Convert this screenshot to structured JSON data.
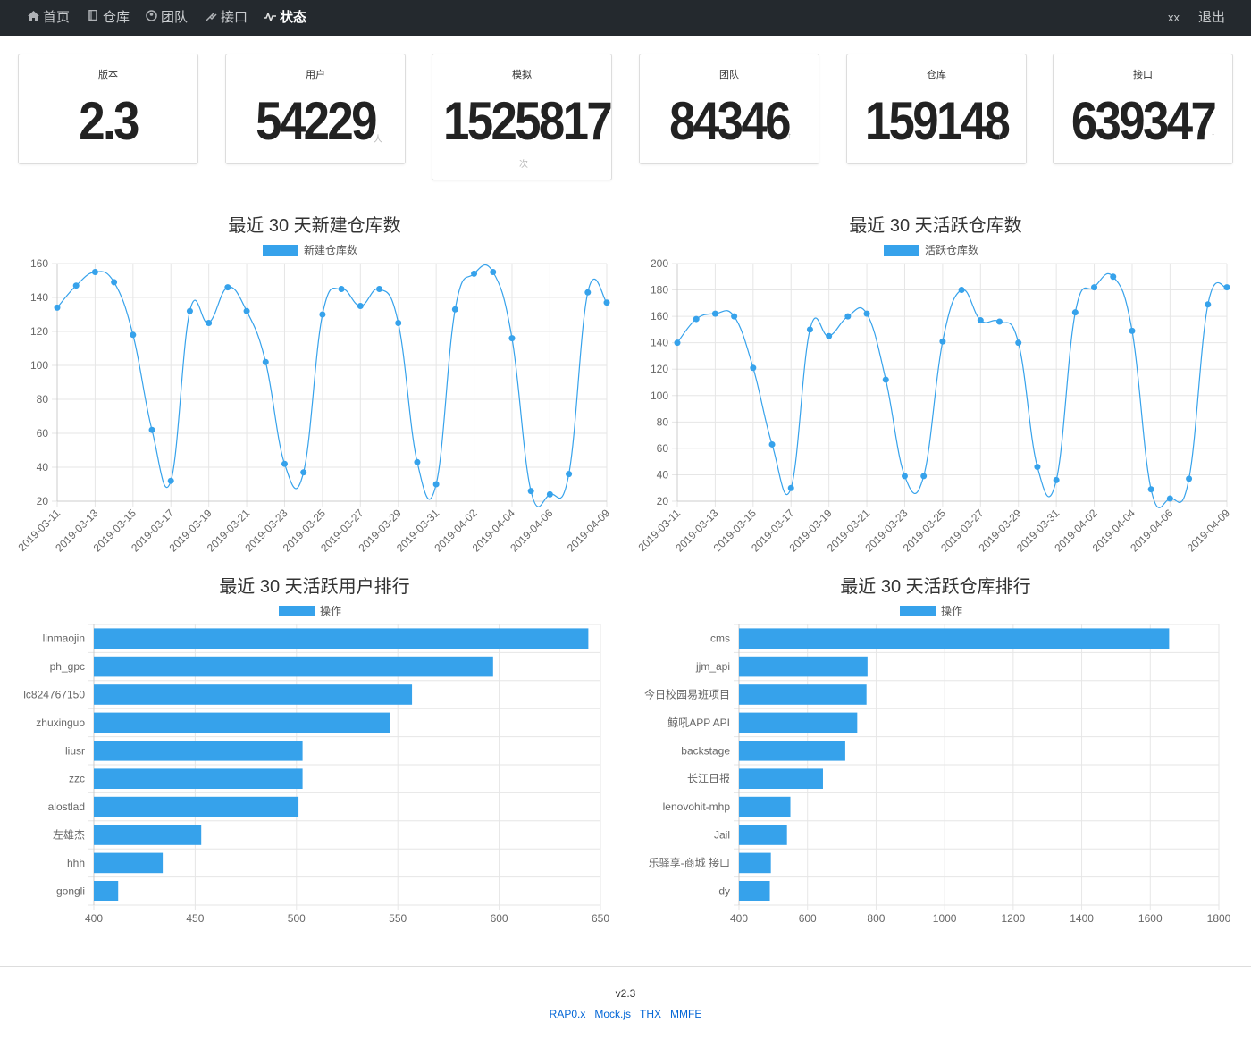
{
  "nav": {
    "items": [
      {
        "label": "首页",
        "icon": "home-icon",
        "active": false
      },
      {
        "label": "仓库",
        "icon": "book-icon",
        "active": false
      },
      {
        "label": "团队",
        "icon": "organization-icon",
        "active": false
      },
      {
        "label": "接口",
        "icon": "plug-icon",
        "active": false
      },
      {
        "label": "状态",
        "icon": "pulse-icon",
        "active": true
      }
    ],
    "user": "xx",
    "logout": "退出"
  },
  "stats": [
    {
      "title": "版本",
      "value": "2.3",
      "unit": ""
    },
    {
      "title": "用户",
      "value": "54229",
      "unit": "人"
    },
    {
      "title": "模拟",
      "value": "1525817",
      "unit": "次"
    },
    {
      "title": "团队",
      "value": "84346",
      "unit": "↑"
    },
    {
      "title": "仓库",
      "value": "159148",
      "unit": "↑"
    },
    {
      "title": "接口",
      "value": "639347",
      "unit": "↑"
    }
  ],
  "colors": {
    "accent": "#36a2eb",
    "navbar": "#24292e",
    "link": "#0366d6"
  },
  "chart_data": [
    {
      "type": "line",
      "title": "最近 30 天新建仓库数",
      "series": [
        {
          "name": "新建仓库数",
          "values": [
            134,
            147,
            155,
            149,
            118,
            62,
            32,
            132,
            125,
            146,
            132,
            102,
            42,
            37,
            130,
            145,
            135,
            145,
            125,
            43,
            30,
            133,
            154,
            155,
            116,
            26,
            24,
            36,
            143,
            137
          ]
        }
      ],
      "x": [
        "2019-03-11",
        "2019-03-12",
        "2019-03-13",
        "2019-03-14",
        "2019-03-15",
        "2019-03-16",
        "2019-03-17",
        "2019-03-18",
        "2019-03-19",
        "2019-03-20",
        "2019-03-21",
        "2019-03-22",
        "2019-03-23",
        "2019-03-24",
        "2019-03-25",
        "2019-03-26",
        "2019-03-27",
        "2019-03-28",
        "2019-03-29",
        "2019-03-30",
        "2019-03-31",
        "2019-04-01",
        "2019-04-02",
        "2019-04-03",
        "2019-04-04",
        "2019-04-05",
        "2019-04-06",
        "2019-04-07",
        "2019-04-08",
        "2019-04-09"
      ],
      "x_tick_labels": [
        "2019-03-11",
        "2019-03-13",
        "2019-03-15",
        "2019-03-17",
        "2019-03-19",
        "2019-03-21",
        "2019-03-23",
        "2019-03-25",
        "2019-03-27",
        "2019-03-29",
        "2019-03-31",
        "2019-04-02",
        "2019-04-04",
        "2019-04-06",
        "2019-04-09"
      ],
      "ylim": [
        20,
        160
      ],
      "y_ticks": [
        20,
        40,
        60,
        80,
        100,
        120,
        140,
        160
      ],
      "legend": "top",
      "grid": true
    },
    {
      "type": "line",
      "title": "最近 30 天活跃仓库数",
      "series": [
        {
          "name": "活跃仓库数",
          "values": [
            140,
            158,
            162,
            160,
            121,
            63,
            30,
            150,
            145,
            160,
            162,
            112,
            39,
            39,
            141,
            180,
            157,
            156,
            140,
            46,
            36,
            163,
            182,
            190,
            149,
            29,
            22,
            37,
            169,
            182
          ]
        }
      ],
      "x": [
        "2019-03-11",
        "2019-03-12",
        "2019-03-13",
        "2019-03-14",
        "2019-03-15",
        "2019-03-16",
        "2019-03-17",
        "2019-03-18",
        "2019-03-19",
        "2019-03-20",
        "2019-03-21",
        "2019-03-22",
        "2019-03-23",
        "2019-03-24",
        "2019-03-25",
        "2019-03-26",
        "2019-03-27",
        "2019-03-28",
        "2019-03-29",
        "2019-03-30",
        "2019-03-31",
        "2019-04-01",
        "2019-04-02",
        "2019-04-03",
        "2019-04-04",
        "2019-04-05",
        "2019-04-06",
        "2019-04-07",
        "2019-04-08",
        "2019-04-09"
      ],
      "x_tick_labels": [
        "2019-03-11",
        "2019-03-13",
        "2019-03-15",
        "2019-03-17",
        "2019-03-19",
        "2019-03-21",
        "2019-03-23",
        "2019-03-25",
        "2019-03-27",
        "2019-03-29",
        "2019-03-31",
        "2019-04-02",
        "2019-04-04",
        "2019-04-06",
        "2019-04-09"
      ],
      "ylim": [
        20,
        200
      ],
      "y_ticks": [
        20,
        40,
        60,
        80,
        100,
        120,
        140,
        160,
        180,
        200
      ],
      "legend": "top",
      "grid": true
    },
    {
      "type": "bar",
      "orientation": "horizontal",
      "title": "最近 30 天活跃用户排行",
      "categories": [
        "linmaojin",
        "ph_gpc",
        "lc824767150",
        "zhuxinguo",
        "liusr",
        "zzc",
        "alostlad",
        "左雄杰",
        "hhh",
        "gongli"
      ],
      "series": [
        {
          "name": "操作",
          "values": [
            644,
            597,
            557,
            546,
            503,
            503,
            501,
            453,
            434,
            412
          ]
        }
      ],
      "xlim": [
        400,
        650
      ],
      "x_ticks": [
        400,
        450,
        500,
        550,
        600,
        650
      ],
      "legend": "top",
      "grid": true
    },
    {
      "type": "bar",
      "orientation": "horizontal",
      "title": "最近 30 天活跃仓库排行",
      "categories": [
        "cms",
        "jjm_api",
        "今日校园易班项目",
        "鲸吼APP API",
        "backstage",
        "长江日报",
        "lenovohit-mhp",
        "Jail",
        "乐驿享-商城 接口",
        "dy"
      ],
      "series": [
        {
          "name": "操作",
          "values": [
            1655,
            775,
            772,
            745,
            710,
            645,
            550,
            540,
            493,
            490
          ]
        }
      ],
      "xlim": [
        400,
        1800
      ],
      "x_ticks": [
        400,
        600,
        800,
        1000,
        1200,
        1400,
        1600,
        1800
      ],
      "legend": "top",
      "grid": true
    }
  ],
  "footer": {
    "version": "v2.3",
    "links": [
      "RAP0.x",
      "Mock.js",
      "THX",
      "MMFE"
    ]
  }
}
